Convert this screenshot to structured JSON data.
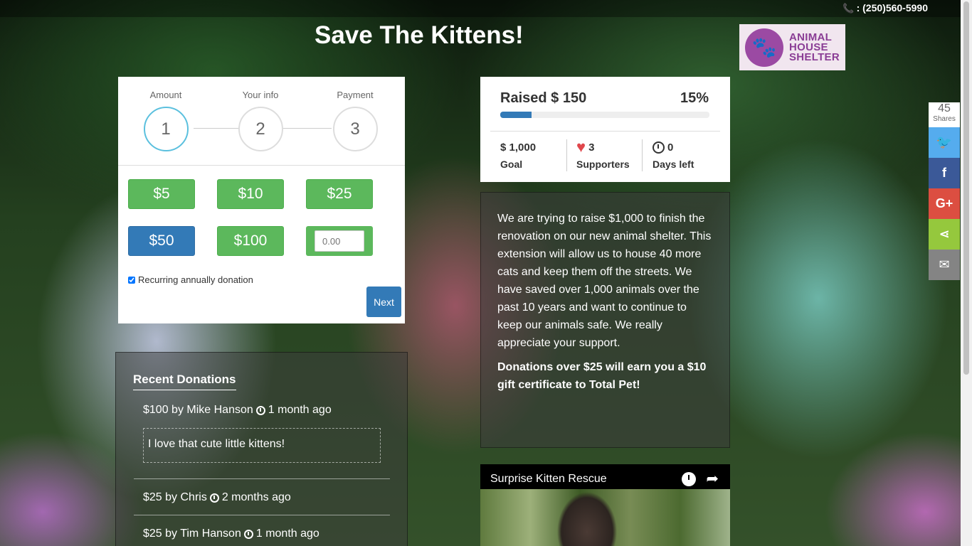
{
  "header": {
    "phone": ": (250)560-5990",
    "title": "Save The Kittens!",
    "logo_text_line1": "ANIMAL",
    "logo_text_line2": "HOUSE",
    "logo_text_line3": "SHELTER"
  },
  "donation_form": {
    "steps": [
      {
        "label": "Amount",
        "number": "1"
      },
      {
        "label": "Your info",
        "number": "2"
      },
      {
        "label": "Payment",
        "number": "3"
      }
    ],
    "amounts": [
      "$5",
      "$10",
      "$25",
      "$50",
      "$100"
    ],
    "custom_placeholder": "0.00",
    "recurring_label": "Recurring annually donation",
    "next_label": "Next"
  },
  "progress": {
    "raised": "Raised $ 150",
    "percent_text": "15%",
    "percent": 0.15,
    "goal_value": "$ 1,000",
    "goal_label": "Goal",
    "supporters_value": "3",
    "supporters_label": "Supporters",
    "days_value": "0",
    "days_label": "Days left"
  },
  "description": {
    "body": "We are trying to raise $1,000 to finish the renovation on our new animal shelter. This extension will allow us to house 40 more cats and keep them off the streets. We have saved over 1,000 animals over the past 10 years and want to continue to keep our animals safe. We really appreciate your support.",
    "promo": "Donations over $25 will earn you a $10 gift certificate to Total Pet!"
  },
  "recent_donations": {
    "heading": "Recent Donations",
    "items": [
      {
        "text": "$100 by Mike Hanson",
        "time": "1 month ago",
        "comment": "I love that cute little kittens!"
      },
      {
        "text": "$25 by Chris",
        "time": "2 months ago"
      },
      {
        "text": "$25 by Tim Hanson",
        "time": "1 month ago"
      }
    ]
  },
  "video": {
    "title": "Surprise Kitten Rescue"
  },
  "share": {
    "count": "45",
    "label": "Shares",
    "buttons": [
      {
        "name": "twitter",
        "color": "#55acee",
        "glyph": "🐦"
      },
      {
        "name": "facebook",
        "color": "#3b5998",
        "glyph": "f"
      },
      {
        "name": "google-plus",
        "color": "#dc4e41",
        "glyph": "G+"
      },
      {
        "name": "share",
        "color": "#95c83d",
        "glyph": "⋖"
      },
      {
        "name": "email",
        "color": "#848484",
        "glyph": "✉"
      }
    ]
  }
}
